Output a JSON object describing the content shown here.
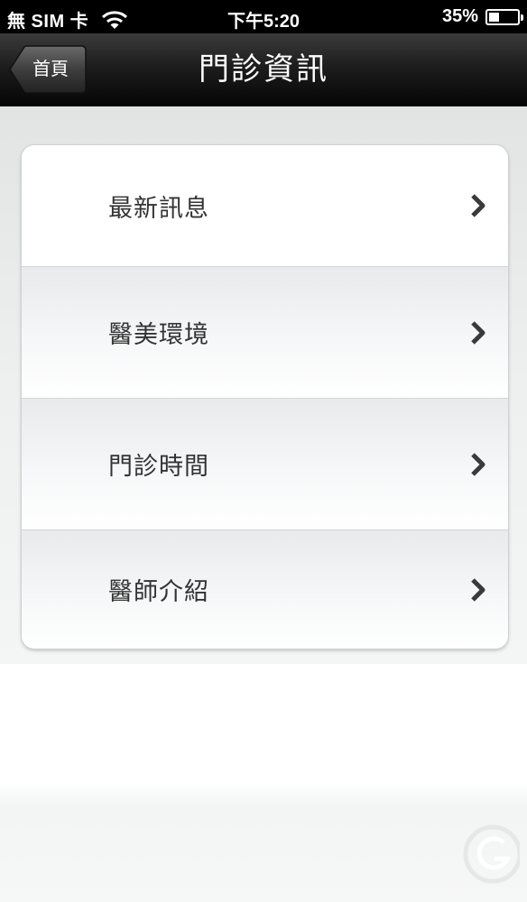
{
  "status_bar": {
    "carrier": "無 SIM 卡",
    "time": "下午5:20",
    "battery_text": "35%",
    "battery_level": 0.35
  },
  "nav": {
    "back_label": "首頁",
    "title": "門診資訊"
  },
  "menu": {
    "items": [
      {
        "label": "最新訊息"
      },
      {
        "label": "醫美環境"
      },
      {
        "label": "門診時間"
      },
      {
        "label": "醫師介紹"
      }
    ]
  },
  "icons": {
    "wifi": "wifi-icon",
    "battery": "battery-icon",
    "chevron": "chevron-right-icon",
    "back": "back-arrow-button"
  },
  "colors": {
    "nav_background": "#1c1c1c",
    "status_background": "#000000",
    "label_text": "#333333",
    "chevron": "#3a3a3a"
  }
}
